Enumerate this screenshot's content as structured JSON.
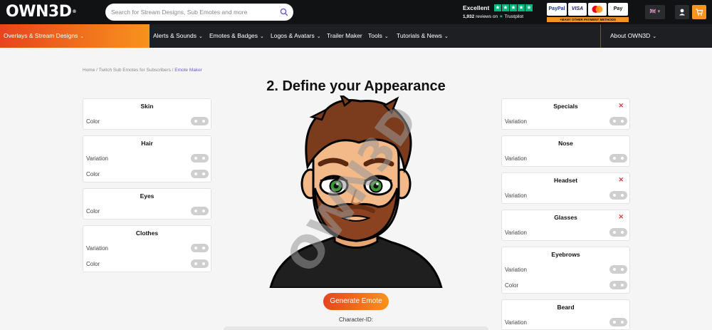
{
  "header": {
    "logo_text": "OWN3D",
    "logo_reg": "®",
    "search_placeholder": "Search for Stream Designs, Sub Emotes and more",
    "trustpilot": {
      "rating_label": "Excellent",
      "review_count": "1,932",
      "reviews_on": "reviews on",
      "brand": "Trustpilot",
      "stars": 5,
      "star_color": "#00b67a"
    },
    "payments": {
      "paypal": "PayPal",
      "visa": "VISA",
      "mastercard": "",
      "applepay": "Pay",
      "note": "+MANY OTHER PAYMENT METHODS"
    },
    "language_flag": "🇬🇧"
  },
  "nav": {
    "items": [
      {
        "label": "Overlays & Stream Designs"
      },
      {
        "label": "Alerts & Sounds"
      },
      {
        "label": "Emotes & Badges"
      },
      {
        "label": "Logos & Avatars"
      },
      {
        "label": "Trailer Maker"
      },
      {
        "label": "Tools"
      },
      {
        "label": "Tutorials & News"
      },
      {
        "label": "About OWN3D"
      }
    ],
    "accent_start": "#e8441e",
    "accent_end": "#f7931e"
  },
  "breadcrumb": {
    "home": "Home",
    "section": "Twitch Sub Emotes for Subscribers",
    "current": "Emote Maker",
    "separator": "/"
  },
  "page_title": "2. Define your Appearance",
  "left_panels": [
    {
      "title": "Skin",
      "rows": [
        "Color"
      ]
    },
    {
      "title": "Hair",
      "rows": [
        "Variation",
        "Color"
      ]
    },
    {
      "title": "Eyes",
      "rows": [
        "Color"
      ]
    },
    {
      "title": "Clothes",
      "rows": [
        "Variation",
        "Color"
      ]
    }
  ],
  "right_panels": [
    {
      "title": "Specials",
      "removable": true,
      "rows": [
        "Variation"
      ]
    },
    {
      "title": "Nose",
      "removable": false,
      "rows": [
        "Variation"
      ]
    },
    {
      "title": "Headset",
      "removable": true,
      "rows": [
        "Variation"
      ]
    },
    {
      "title": "Glasses",
      "removable": true,
      "rows": [
        "Variation"
      ]
    },
    {
      "title": "Eyebrows",
      "removable": false,
      "rows": [
        "Variation",
        "Color"
      ]
    },
    {
      "title": "Beard",
      "removable": false,
      "rows": [
        "Variation"
      ]
    }
  ],
  "remove_glyph": "✕",
  "generate_button": "Generate Emote",
  "character_id_label": "Character-ID:",
  "watermark_text": "OWN3D"
}
